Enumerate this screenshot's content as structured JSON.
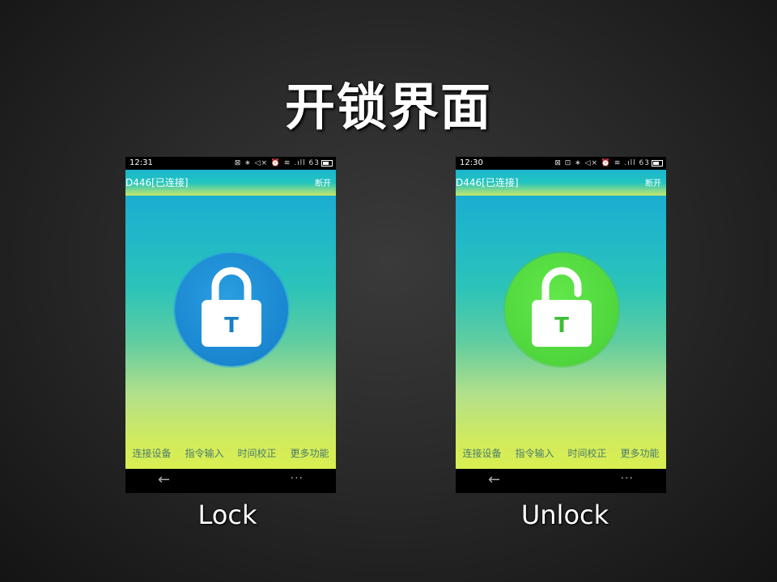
{
  "slide": {
    "title": "开锁界面"
  },
  "phones": [
    {
      "status_time": "12:31",
      "status_icons": "⊠ ∗ ◁× ⏰ ≋ .ıll 63",
      "device_name": "D446[已连接]",
      "disconnect_label": "断开",
      "lock_state": "locked",
      "lock_letter": "T",
      "circle_color": "#1a86d0",
      "menu": [
        "连接设备",
        "指令输入",
        "时间校正",
        "更多功能"
      ],
      "nav_back": "←",
      "nav_menu": "···",
      "caption": "Lock"
    },
    {
      "status_time": "12:30",
      "status_icons": "⊠ ⊡ ∗ ◁× ⏰ ≋ .ıll 63",
      "device_name": "D446[已连接]",
      "disconnect_label": "断开",
      "lock_state": "unlocked",
      "lock_letter": "T",
      "circle_color": "#4fd63c",
      "menu": [
        "连接设备",
        "指令输入",
        "时间校正",
        "更多功能"
      ],
      "nav_back": "←",
      "nav_menu": "···",
      "caption": "Unlock"
    }
  ]
}
